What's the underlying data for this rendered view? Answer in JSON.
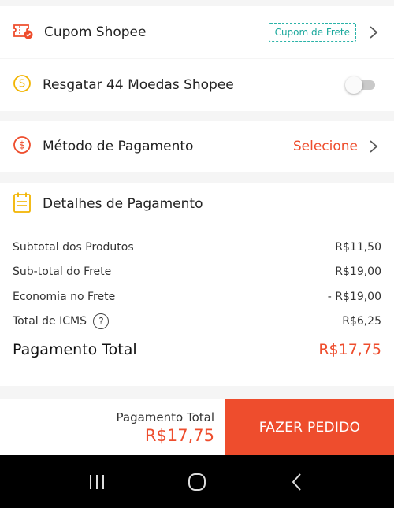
{
  "coupon": {
    "label": "Cupom Shopee",
    "tag": "Cupom de Frete"
  },
  "coins": {
    "label": "Resgatar 44 Moedas Shopee",
    "enabled": false
  },
  "payment_method": {
    "label": "Método de Pagamento",
    "action": "Selecione"
  },
  "details": {
    "title": "Detalhes de Pagamento",
    "lines": [
      {
        "label": "Subtotal dos Produtos",
        "value": "R$11,50"
      },
      {
        "label": "Sub-total do Frete",
        "value": "R$19,00"
      },
      {
        "label": "Economia no Frete",
        "value": "- R$19,00"
      },
      {
        "label": "Total de ICMS",
        "value": "R$6,25",
        "help": "?"
      }
    ],
    "total_label": "Pagamento Total",
    "total_value": "R$17,75"
  },
  "bottom": {
    "total_label": "Pagamento Total",
    "total_value": "R$17,75",
    "order_button": "FAZER PEDIDO"
  },
  "colors": {
    "accent": "#ee4d2d",
    "teal": "#2bb3a8",
    "gold": "#f2b400"
  }
}
